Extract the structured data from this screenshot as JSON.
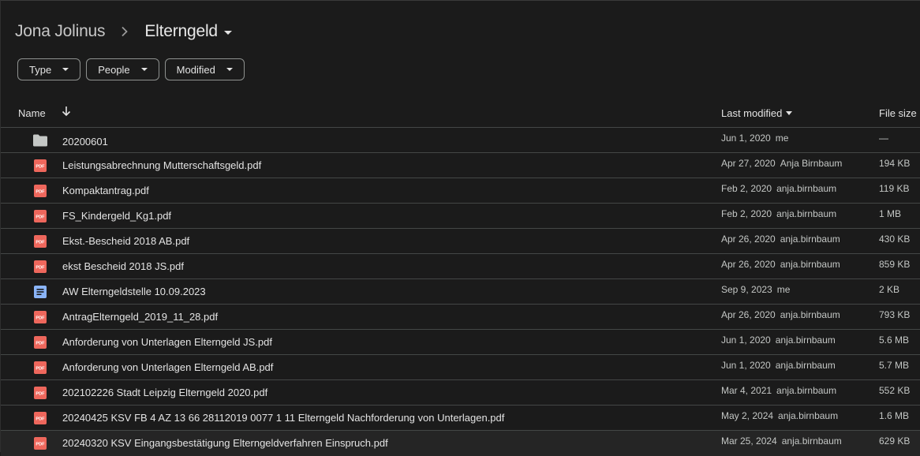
{
  "breadcrumb": {
    "root": "Jona Jolinus",
    "current": "Elterngeld"
  },
  "filters": [
    "Type",
    "People",
    "Modified"
  ],
  "columns": {
    "name": "Name",
    "last_modified": "Last modified",
    "file_size": "File size"
  },
  "files": [
    {
      "type": "folder",
      "name": "20200601",
      "date": "Jun 1, 2020",
      "owner": "me",
      "size": "—"
    },
    {
      "type": "pdf",
      "name": "Leistungsabrechnung Mutterschaftsgeld.pdf",
      "date": "Apr 27, 2020",
      "owner": "Anja Birnbaum",
      "size": "194 KB"
    },
    {
      "type": "pdf",
      "name": "Kompaktantrag.pdf",
      "date": "Feb 2, 2020",
      "owner": "anja.birnbaum",
      "size": "119 KB"
    },
    {
      "type": "pdf",
      "name": "FS_Kindergeld_Kg1.pdf",
      "date": "Feb 2, 2020",
      "owner": "anja.birnbaum",
      "size": "1 MB"
    },
    {
      "type": "pdf",
      "name": "Ekst.-Bescheid 2018 AB.pdf",
      "date": "Apr 26, 2020",
      "owner": "anja.birnbaum",
      "size": "430 KB"
    },
    {
      "type": "pdf",
      "name": "ekst Bescheid 2018 JS.pdf",
      "date": "Apr 26, 2020",
      "owner": "anja.birnbaum",
      "size": "859 KB"
    },
    {
      "type": "doc",
      "name": "AW Elterngeldstelle 10.09.2023",
      "date": "Sep 9, 2023",
      "owner": "me",
      "size": "2 KB"
    },
    {
      "type": "pdf",
      "name": "AntragElterngeld_2019_11_28.pdf",
      "date": "Apr 26, 2020",
      "owner": "anja.birnbaum",
      "size": "793 KB"
    },
    {
      "type": "pdf",
      "name": "Anforderung von Unterlagen Elterngeld JS.pdf",
      "date": "Jun 1, 2020",
      "owner": "anja.birnbaum",
      "size": "5.6 MB"
    },
    {
      "type": "pdf",
      "name": "Anforderung von Unterlagen Elterngeld AB.pdf",
      "date": "Jun 1, 2020",
      "owner": "anja.birnbaum",
      "size": "5.7 MB"
    },
    {
      "type": "pdf",
      "name": "202102226 Stadt Leipzig Elterngeld 2020.pdf",
      "date": "Mar 4, 2021",
      "owner": "anja.birnbaum",
      "size": "552 KB"
    },
    {
      "type": "pdf",
      "name": "20240425 KSV FB 4 AZ 13 66 28112019 0077 1 11 Elterngeld Nachforderung von Unterlagen.pdf",
      "date": "May 2, 2024",
      "owner": "anja.birnbaum",
      "size": "1.6 MB"
    },
    {
      "type": "pdf",
      "name": "20240320 KSV Eingangsbestätigung Elterngeldverfahren Einspruch.pdf",
      "date": "Mar 25, 2024",
      "owner": "anja.birnbaum",
      "size": "629 KB"
    }
  ],
  "icon_names": {
    "folder": "folder-icon",
    "pdf": "pdf-icon",
    "doc": "google-doc-icon"
  },
  "colors": {
    "pdf": "#ee675c",
    "doc": "#8ab4f8",
    "folder": "#c4c7c5"
  }
}
